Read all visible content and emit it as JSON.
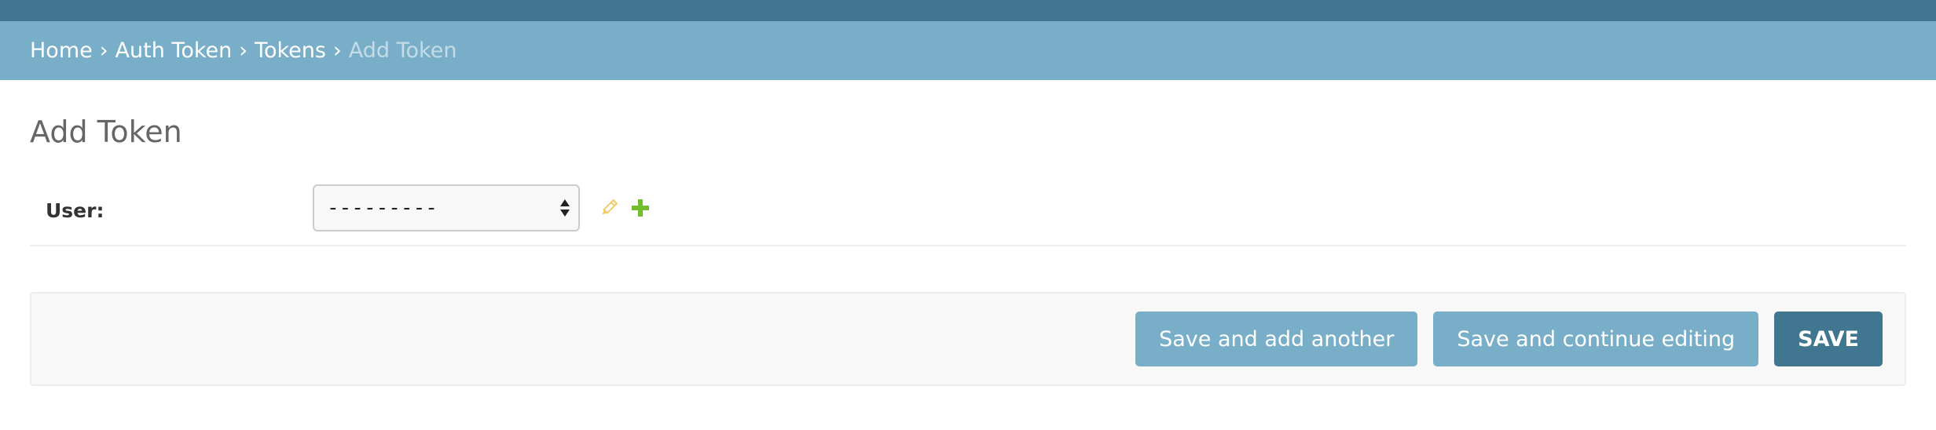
{
  "breadcrumbs": {
    "home": "Home",
    "app": "Auth Token",
    "model": "Tokens",
    "current": "Add Token",
    "separator": "›"
  },
  "page": {
    "title": "Add Token"
  },
  "form": {
    "user_label": "User:",
    "user_value": "---------"
  },
  "icons": {
    "edit": "pencil-icon",
    "add": "plus-icon",
    "select": "updown-arrows-icon"
  },
  "actions": {
    "save_add_another": "Save and add another",
    "save_continue": "Save and continue editing",
    "save": "SAVE"
  },
  "colors": {
    "header": "#417690",
    "breadcrumbs_bg": "#79aec8",
    "primary_button": "#417690",
    "secondary_button": "#79aec8",
    "edit_icon": "#efcb6a",
    "add_icon": "#70bf2b"
  }
}
